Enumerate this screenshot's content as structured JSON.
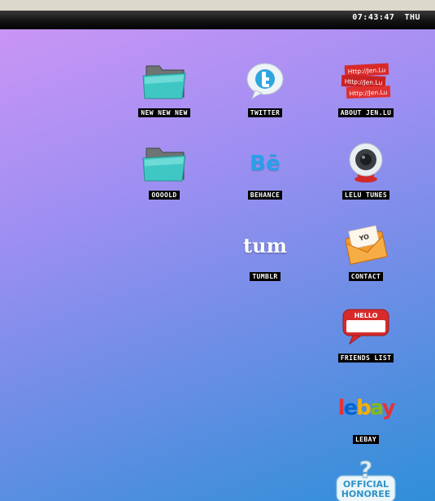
{
  "menubar": {
    "time": "07:43:47",
    "day": "THU"
  },
  "icons": {
    "new_new_new": {
      "label": "NEW NEW NEW",
      "icon": "folder-icon"
    },
    "twitter": {
      "label": "TWITTER",
      "icon": "twitter-bird-icon"
    },
    "about": {
      "label": "ABOUT JEN.LU",
      "icon": "name-stickers-icon",
      "art_text": "Http://Jen.Lu"
    },
    "ooold": {
      "label": "OOOOLD",
      "icon": "folder-icon"
    },
    "behance": {
      "label": "BEHANCE",
      "icon": "behance-logo-icon",
      "art_text": "Bē"
    },
    "lelu_tunes": {
      "label": "LELU TUNES",
      "icon": "speaker-icon"
    },
    "tumblr": {
      "label": "TUMBLR",
      "icon": "tumblr-logo-icon",
      "art_text": "tum"
    },
    "contact": {
      "label": "CONTACT",
      "icon": "envelope-icon",
      "art_text": "YO"
    },
    "friends_list": {
      "label": "FRIENDS LIST",
      "icon": "hello-speech-bubble-icon",
      "art_text": "HELLO"
    },
    "lebay": {
      "label": "LEBAY",
      "icon": "lebay-logo-icon",
      "art_text": [
        "l",
        "e",
        "b",
        "a",
        "y"
      ]
    },
    "official_honoree": {
      "label": "",
      "icon": "official-honoree-badge-icon",
      "art_text": [
        "OFFICIAL",
        "HONOREE"
      ]
    }
  },
  "colors": {
    "desktop_top_left": "#c995f5",
    "desktop_bottom_right": "#2f8fd8",
    "folder_teal": "#3fc7c4",
    "menubar": "#141414"
  }
}
